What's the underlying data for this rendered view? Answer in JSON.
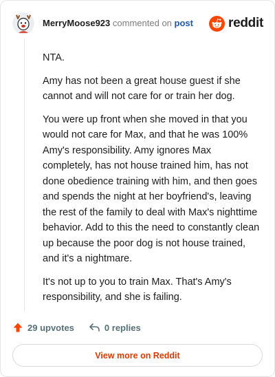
{
  "comment": {
    "username": "MerryMoose923",
    "action_text": "commented on",
    "post_link_label": "post",
    "paragraphs": [
      "NTA.",
      "Amy has not been a great house guest if she cannot and will not care for or train her dog.",
      "You were up front when she moved in that you would not care for Max, and that he was 100% Amy's responsibility. Amy ignores Max completely, has not house trained him, has not done obedience training with him, and then goes and spends the night at her boyfriend's, leaving the rest of the family to deal with Max's nighttime behavior. Add to this the need to constantly clean up because the poor dog is not house trained, and it's a nightmare.",
      "It's not up to you to train Max. That's Amy's responsibility, and she is failing."
    ]
  },
  "brand": {
    "name": "reddit",
    "icon": "reddit-snoo-icon",
    "color": "#ff4500"
  },
  "footer": {
    "upvotes_label": "29 upvotes",
    "upvote_icon": "upvote-arrow-icon",
    "upvote_color": "#ff4500",
    "replies_label": "0 replies",
    "reply_icon": "reply-arrow-icon"
  },
  "view_more_label": "View more on Reddit"
}
